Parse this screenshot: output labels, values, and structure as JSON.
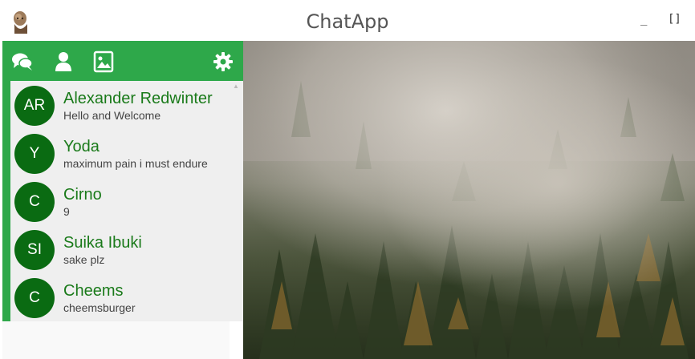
{
  "window": {
    "title": "ChatApp",
    "minimize_label": "_",
    "maximize_label": "[]"
  },
  "toolbar": {
    "icons": [
      "chat-bubbles-icon",
      "user-icon",
      "image-icon",
      "gear-icon"
    ],
    "color": "#2ea84a"
  },
  "contacts": [
    {
      "initials": "AR",
      "name": "Alexander Redwinter",
      "last_message": "Hello and Welcome"
    },
    {
      "initials": "Y",
      "name": "Yoda",
      "last_message": "maximum pain i must endure"
    },
    {
      "initials": "C",
      "name": "Cirno",
      "last_message": "9"
    },
    {
      "initials": "SI",
      "name": "Suika Ibuki",
      "last_message": "sake plz"
    },
    {
      "initials": "C",
      "name": "Cheems",
      "last_message": "cheemsburger"
    }
  ],
  "colors": {
    "accent": "#2ea84a",
    "avatar": "#0a6b12",
    "contact_name": "#1a7a1a",
    "list_background": "#efefef"
  }
}
